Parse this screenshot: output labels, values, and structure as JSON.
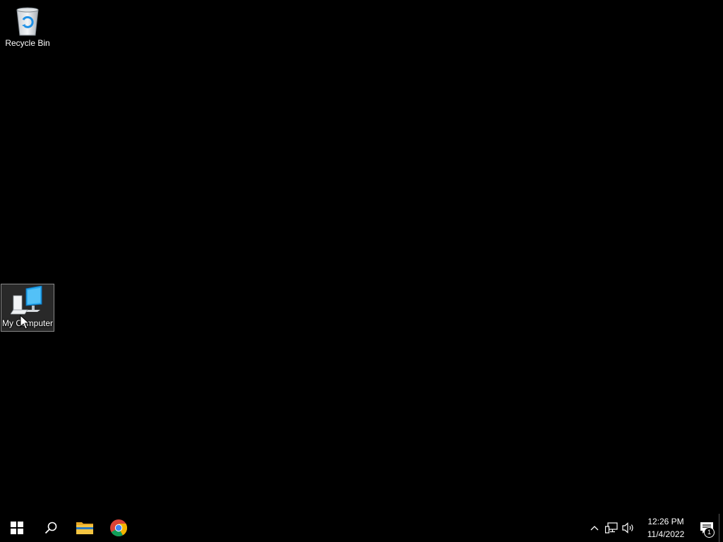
{
  "desktop": {
    "icons": [
      {
        "label": "Recycle Bin",
        "icon": "recycle-bin-icon"
      },
      {
        "label": "My Computer",
        "icon": "computer-icon",
        "selected": true
      }
    ]
  },
  "taskbar": {
    "start": {
      "icon": "windows-start-icon"
    },
    "search": {
      "icon": "search-icon"
    },
    "pinned": [
      {
        "icon": "file-explorer-icon"
      },
      {
        "icon": "chrome-icon"
      }
    ],
    "tray": {
      "icons": [
        "chevron-up-icon",
        "network-icon",
        "volume-icon"
      ],
      "time": "12:26 PM",
      "date": "11/4/2022",
      "notification_count": "1"
    }
  },
  "colors": {
    "background": "#000000",
    "text": "#ffffff",
    "accent_blue": "#1e90e6",
    "folder_yellow": "#f4c542"
  }
}
